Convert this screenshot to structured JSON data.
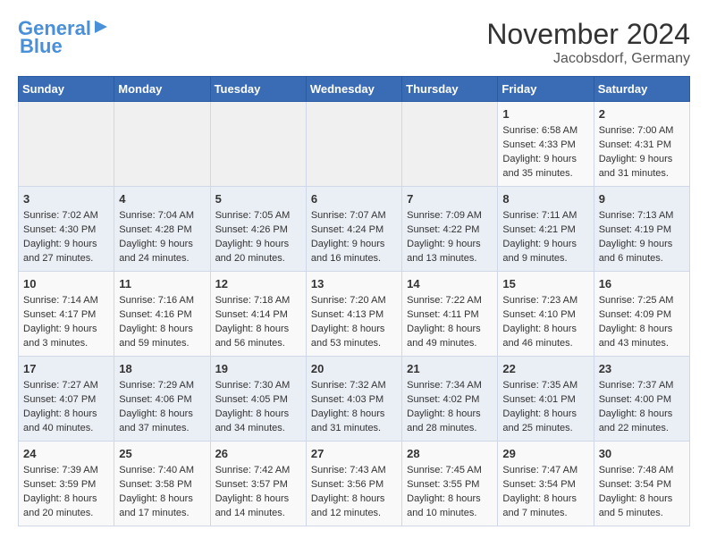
{
  "header": {
    "logo_line1": "General",
    "logo_line2": "Blue",
    "title": "November 2024",
    "location": "Jacobsdorf, Germany"
  },
  "days_of_week": [
    "Sunday",
    "Monday",
    "Tuesday",
    "Wednesday",
    "Thursday",
    "Friday",
    "Saturday"
  ],
  "weeks": [
    [
      {
        "day": "",
        "info": ""
      },
      {
        "day": "",
        "info": ""
      },
      {
        "day": "",
        "info": ""
      },
      {
        "day": "",
        "info": ""
      },
      {
        "day": "",
        "info": ""
      },
      {
        "day": "1",
        "info": "Sunrise: 6:58 AM\nSunset: 4:33 PM\nDaylight: 9 hours and 35 minutes."
      },
      {
        "day": "2",
        "info": "Sunrise: 7:00 AM\nSunset: 4:31 PM\nDaylight: 9 hours and 31 minutes."
      }
    ],
    [
      {
        "day": "3",
        "info": "Sunrise: 7:02 AM\nSunset: 4:30 PM\nDaylight: 9 hours and 27 minutes."
      },
      {
        "day": "4",
        "info": "Sunrise: 7:04 AM\nSunset: 4:28 PM\nDaylight: 9 hours and 24 minutes."
      },
      {
        "day": "5",
        "info": "Sunrise: 7:05 AM\nSunset: 4:26 PM\nDaylight: 9 hours and 20 minutes."
      },
      {
        "day": "6",
        "info": "Sunrise: 7:07 AM\nSunset: 4:24 PM\nDaylight: 9 hours and 16 minutes."
      },
      {
        "day": "7",
        "info": "Sunrise: 7:09 AM\nSunset: 4:22 PM\nDaylight: 9 hours and 13 minutes."
      },
      {
        "day": "8",
        "info": "Sunrise: 7:11 AM\nSunset: 4:21 PM\nDaylight: 9 hours and 9 minutes."
      },
      {
        "day": "9",
        "info": "Sunrise: 7:13 AM\nSunset: 4:19 PM\nDaylight: 9 hours and 6 minutes."
      }
    ],
    [
      {
        "day": "10",
        "info": "Sunrise: 7:14 AM\nSunset: 4:17 PM\nDaylight: 9 hours and 3 minutes."
      },
      {
        "day": "11",
        "info": "Sunrise: 7:16 AM\nSunset: 4:16 PM\nDaylight: 8 hours and 59 minutes."
      },
      {
        "day": "12",
        "info": "Sunrise: 7:18 AM\nSunset: 4:14 PM\nDaylight: 8 hours and 56 minutes."
      },
      {
        "day": "13",
        "info": "Sunrise: 7:20 AM\nSunset: 4:13 PM\nDaylight: 8 hours and 53 minutes."
      },
      {
        "day": "14",
        "info": "Sunrise: 7:22 AM\nSunset: 4:11 PM\nDaylight: 8 hours and 49 minutes."
      },
      {
        "day": "15",
        "info": "Sunrise: 7:23 AM\nSunset: 4:10 PM\nDaylight: 8 hours and 46 minutes."
      },
      {
        "day": "16",
        "info": "Sunrise: 7:25 AM\nSunset: 4:09 PM\nDaylight: 8 hours and 43 minutes."
      }
    ],
    [
      {
        "day": "17",
        "info": "Sunrise: 7:27 AM\nSunset: 4:07 PM\nDaylight: 8 hours and 40 minutes."
      },
      {
        "day": "18",
        "info": "Sunrise: 7:29 AM\nSunset: 4:06 PM\nDaylight: 8 hours and 37 minutes."
      },
      {
        "day": "19",
        "info": "Sunrise: 7:30 AM\nSunset: 4:05 PM\nDaylight: 8 hours and 34 minutes."
      },
      {
        "day": "20",
        "info": "Sunrise: 7:32 AM\nSunset: 4:03 PM\nDaylight: 8 hours and 31 minutes."
      },
      {
        "day": "21",
        "info": "Sunrise: 7:34 AM\nSunset: 4:02 PM\nDaylight: 8 hours and 28 minutes."
      },
      {
        "day": "22",
        "info": "Sunrise: 7:35 AM\nSunset: 4:01 PM\nDaylight: 8 hours and 25 minutes."
      },
      {
        "day": "23",
        "info": "Sunrise: 7:37 AM\nSunset: 4:00 PM\nDaylight: 8 hours and 22 minutes."
      }
    ],
    [
      {
        "day": "24",
        "info": "Sunrise: 7:39 AM\nSunset: 3:59 PM\nDaylight: 8 hours and 20 minutes."
      },
      {
        "day": "25",
        "info": "Sunrise: 7:40 AM\nSunset: 3:58 PM\nDaylight: 8 hours and 17 minutes."
      },
      {
        "day": "26",
        "info": "Sunrise: 7:42 AM\nSunset: 3:57 PM\nDaylight: 8 hours and 14 minutes."
      },
      {
        "day": "27",
        "info": "Sunrise: 7:43 AM\nSunset: 3:56 PM\nDaylight: 8 hours and 12 minutes."
      },
      {
        "day": "28",
        "info": "Sunrise: 7:45 AM\nSunset: 3:55 PM\nDaylight: 8 hours and 10 minutes."
      },
      {
        "day": "29",
        "info": "Sunrise: 7:47 AM\nSunset: 3:54 PM\nDaylight: 8 hours and 7 minutes."
      },
      {
        "day": "30",
        "info": "Sunrise: 7:48 AM\nSunset: 3:54 PM\nDaylight: 8 hours and 5 minutes."
      }
    ]
  ]
}
